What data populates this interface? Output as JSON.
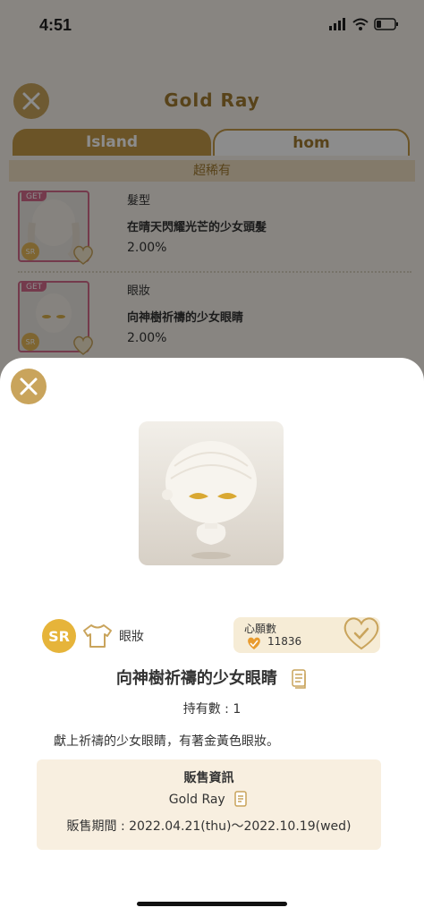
{
  "status": {
    "time": "4:51"
  },
  "header": {
    "title": "Gold Ray"
  },
  "tabs": [
    {
      "label": "Island"
    },
    {
      "label": "hom"
    }
  ],
  "rarity_label": "超稀有",
  "items": [
    {
      "get": "GET",
      "sr": "SR",
      "category": "髮型",
      "name": "在晴天閃耀光芒的少女頭髮",
      "percent": "2.00%"
    },
    {
      "get": "GET",
      "sr": "SR",
      "category": "眼妝",
      "name": "向神樹祈禱的少女眼睛",
      "percent": "2.00%"
    }
  ],
  "detail": {
    "rarity": "SR",
    "category": "眼妝",
    "wish_label": "心願數",
    "wish_count": "11836",
    "title": "向神樹祈禱的少女眼睛",
    "owned": "持有數 : 1",
    "description": "獻上祈禱的少女眼睛，有著金黃色眼妝。",
    "sale": {
      "heading": "販售資訊",
      "name": "Gold Ray",
      "period": "販售期間 : 2022.04.21(thu)～2022.10.19(wed)"
    }
  },
  "colors": {
    "accent": "#c9a45c",
    "rarity_pink": "#d46a8a",
    "sr_gold": "#e6b43a"
  }
}
